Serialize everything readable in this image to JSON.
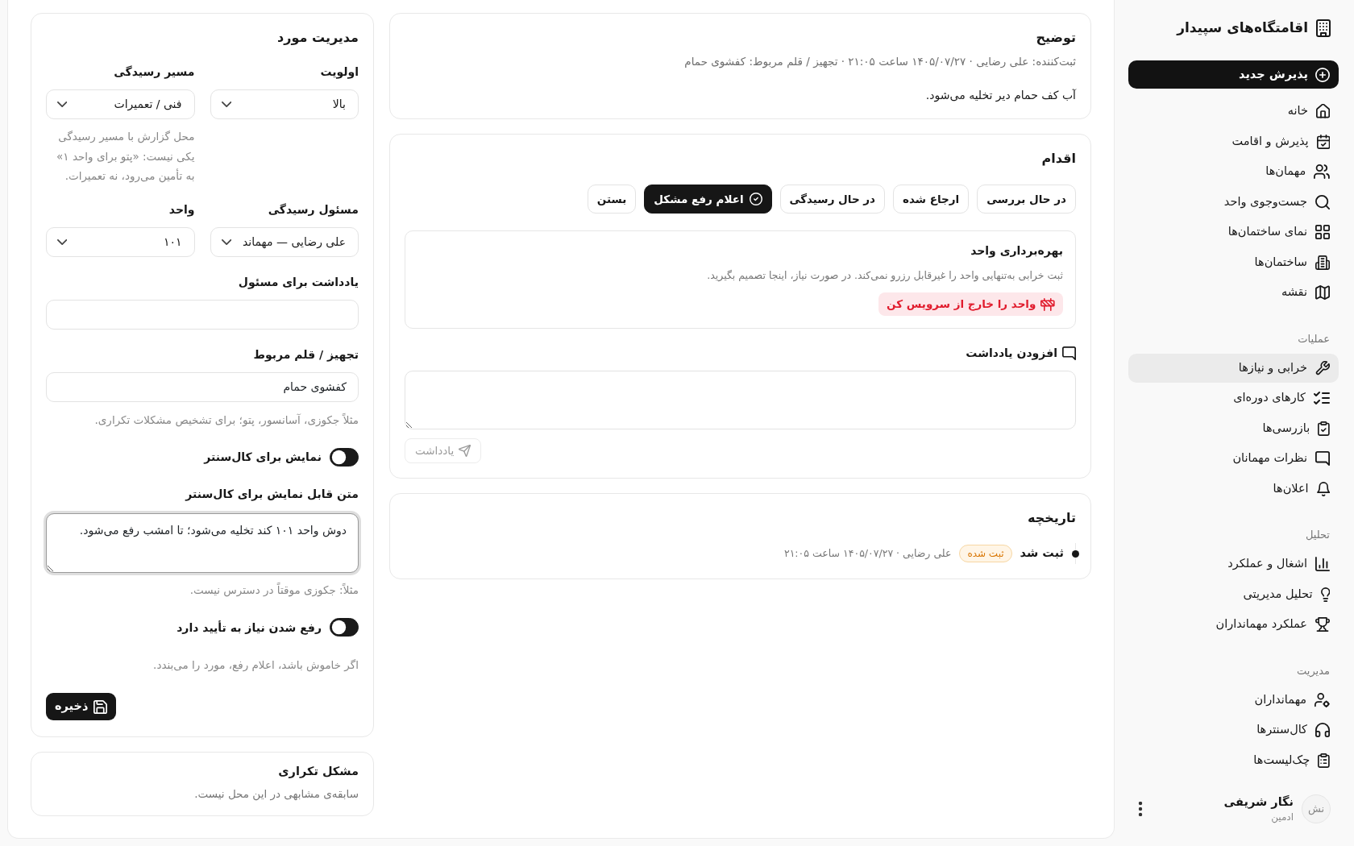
{
  "sidebar": {
    "brand": "اقامتگاه‌های سپیدار",
    "new_button": "پذیرش جدید",
    "groups": [
      {
        "items": [
          {
            "label": "خانه",
            "selected": false
          },
          {
            "label": "پذیرش و اقامت",
            "selected": false
          },
          {
            "label": "مهمان‌ها",
            "selected": false
          },
          {
            "label": "جست‌وجوی واحد",
            "selected": false
          },
          {
            "label": "نمای ساختمان‌ها",
            "selected": false
          },
          {
            "label": "ساختمان‌ها",
            "selected": false
          },
          {
            "label": "نقشه",
            "selected": false
          }
        ]
      },
      {
        "heading": "عملیات",
        "items": [
          {
            "label": "خرابی و نیازها",
            "selected": true
          },
          {
            "label": "کارهای دوره‌ای",
            "selected": false
          },
          {
            "label": "بازرسی‌ها",
            "selected": false
          },
          {
            "label": "نظرات مهمانان",
            "selected": false
          },
          {
            "label": "اعلان‌ها",
            "selected": false
          }
        ]
      },
      {
        "heading": "تحلیل",
        "items": [
          {
            "label": "اشغال و عملکرد",
            "selected": false
          },
          {
            "label": "تحلیل مدیریتی",
            "selected": false
          },
          {
            "label": "عملکرد مهمانداران",
            "selected": false
          }
        ]
      },
      {
        "heading": "مدیریت",
        "items": [
          {
            "label": "مهمانداران",
            "selected": false
          },
          {
            "label": "کال‌سنترها",
            "selected": false
          },
          {
            "label": "چک‌لیست‌ها",
            "selected": false
          }
        ]
      }
    ],
    "user": {
      "initials": "نش",
      "name": "نگار شریفی",
      "role": "ادمین"
    }
  },
  "description": {
    "title": "توضیح",
    "meta": "ثبت‌کننده: علی رضایی · ۱۴۰۵/۰۷/۲۷ ساعت ۲۱:۰۵ · تجهیز / قلم مربوط: کفشوی حمام",
    "body": "آب کف حمام دیر تخلیه می‌شود."
  },
  "action": {
    "title": "اقدام",
    "statuses": [
      {
        "label": "در حال بررسی",
        "selected": false
      },
      {
        "label": "ارجاع شده",
        "selected": false
      },
      {
        "label": "در حال رسیدگی",
        "selected": false
      },
      {
        "label": "اعلام رفع مشکل",
        "selected": true
      },
      {
        "label": "بستن",
        "selected": false
      }
    ],
    "unit_operation": {
      "title": "بهره‌برداری واحد",
      "text": "ثبت خرابی به‌تنهایی واحد را غیرقابل رزرو نمی‌کند. در صورت نیاز، اینجا تصمیم بگیرید.",
      "button": "واحد را خارج از سرویس کن"
    },
    "note": {
      "label": "افزودن یادداشت",
      "button": {
        "label": "یادداشت",
        "disabled": true
      }
    }
  },
  "history": {
    "title": "تاریخچه",
    "entries": [
      {
        "event": "ثبت شد",
        "status": "ثبت شده",
        "meta": "علی رضایی · ۱۴۰۵/۰۷/۲۷ ساعت ۲۱:۰۵"
      }
    ]
  },
  "management": {
    "title": "مدیریت مورد",
    "priority": {
      "label": "اولویت",
      "value": "بالا"
    },
    "route": {
      "label": "مسیر رسیدگی",
      "value": "فنی / تعمیرات",
      "help": "محل گزارش با مسیر رسیدگی یکی نیست: «پتو برای واحد ۱» به تأمین می‌رود، نه تعمیرات."
    },
    "assignee": {
      "label": "مسئول رسیدگی",
      "value": "علی رضایی — مهماند"
    },
    "unit": {
      "label": "واحد",
      "value": "۱۰۱"
    },
    "assignee_note": {
      "label": "یادداشت برای مسئول"
    },
    "equipment": {
      "label": "تجهیز / قلم مربوط",
      "value": "کفشوی حمام",
      "help": "مثلاً جکوزی، آسانسور، پتو؛ برای تشخیص مشکلات تکراری."
    },
    "show_callcenter": {
      "label": "نمایش برای کال‌سنتر",
      "on": true
    },
    "callcenter_text": {
      "label": "متن قابل نمایش برای کال‌سنتر",
      "value": "دوش واحد ۱۰۱ کند تخلیه می‌شود؛ تا امشب رفع می‌شود.",
      "focused": true,
      "help": "مثلاً: جکوزی موقتاً در دسترس نیست."
    },
    "requires_approval": {
      "label": "رفع شدن نیاز به تأیید دارد",
      "on": true,
      "help": "اگر خاموش باشد، اعلام رفع، مورد را می‌بندد."
    },
    "save_button": "ذخیره"
  },
  "recurring": {
    "title": "مشکل تکراری",
    "text": "سابقه‌ی مشابهی در این محل نیست."
  }
}
